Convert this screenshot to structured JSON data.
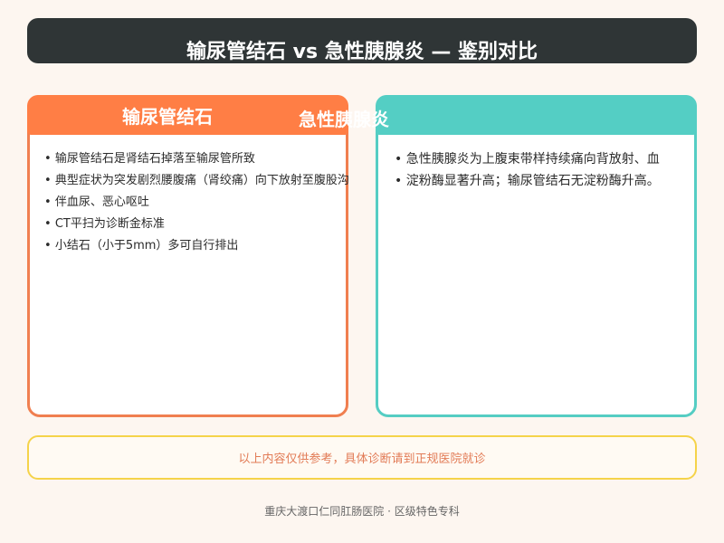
{
  "header": {
    "title": "输尿管结石 vs 急性胰腺炎 — 鉴别对比"
  },
  "left_card": {
    "title": "输尿管结石",
    "items": [
      "输尿管结石是肾结石掉落至输尿管所致",
      "典型症状为突发剧烈腰腹痛（肾绞痛）向下放射至腹股沟",
      "伴血尿、恶心呕吐",
      "CT平扫为诊断金标准",
      "小结石（小于5mm）多可自行排出"
    ]
  },
  "right_card": {
    "title": "急性胰腺炎",
    "items": [
      "急性胰腺炎为上腹束带样持续痛向背放射、血",
      "淀粉酶显著升高；输尿管结石无淀粉酶升高。"
    ]
  },
  "notice": {
    "text": "以上内容仅供参考，具体诊断请到正规医院就诊"
  },
  "footer": {
    "text": "重庆大渡口仁同肛肠医院 · 区级特色专科"
  },
  "colors": {
    "title_bar": "#2f3536",
    "left_accent": "#ff7e45",
    "right_accent": "#54cec4",
    "notice_border": "#f5d34a",
    "notice_text": "#e27b56"
  }
}
